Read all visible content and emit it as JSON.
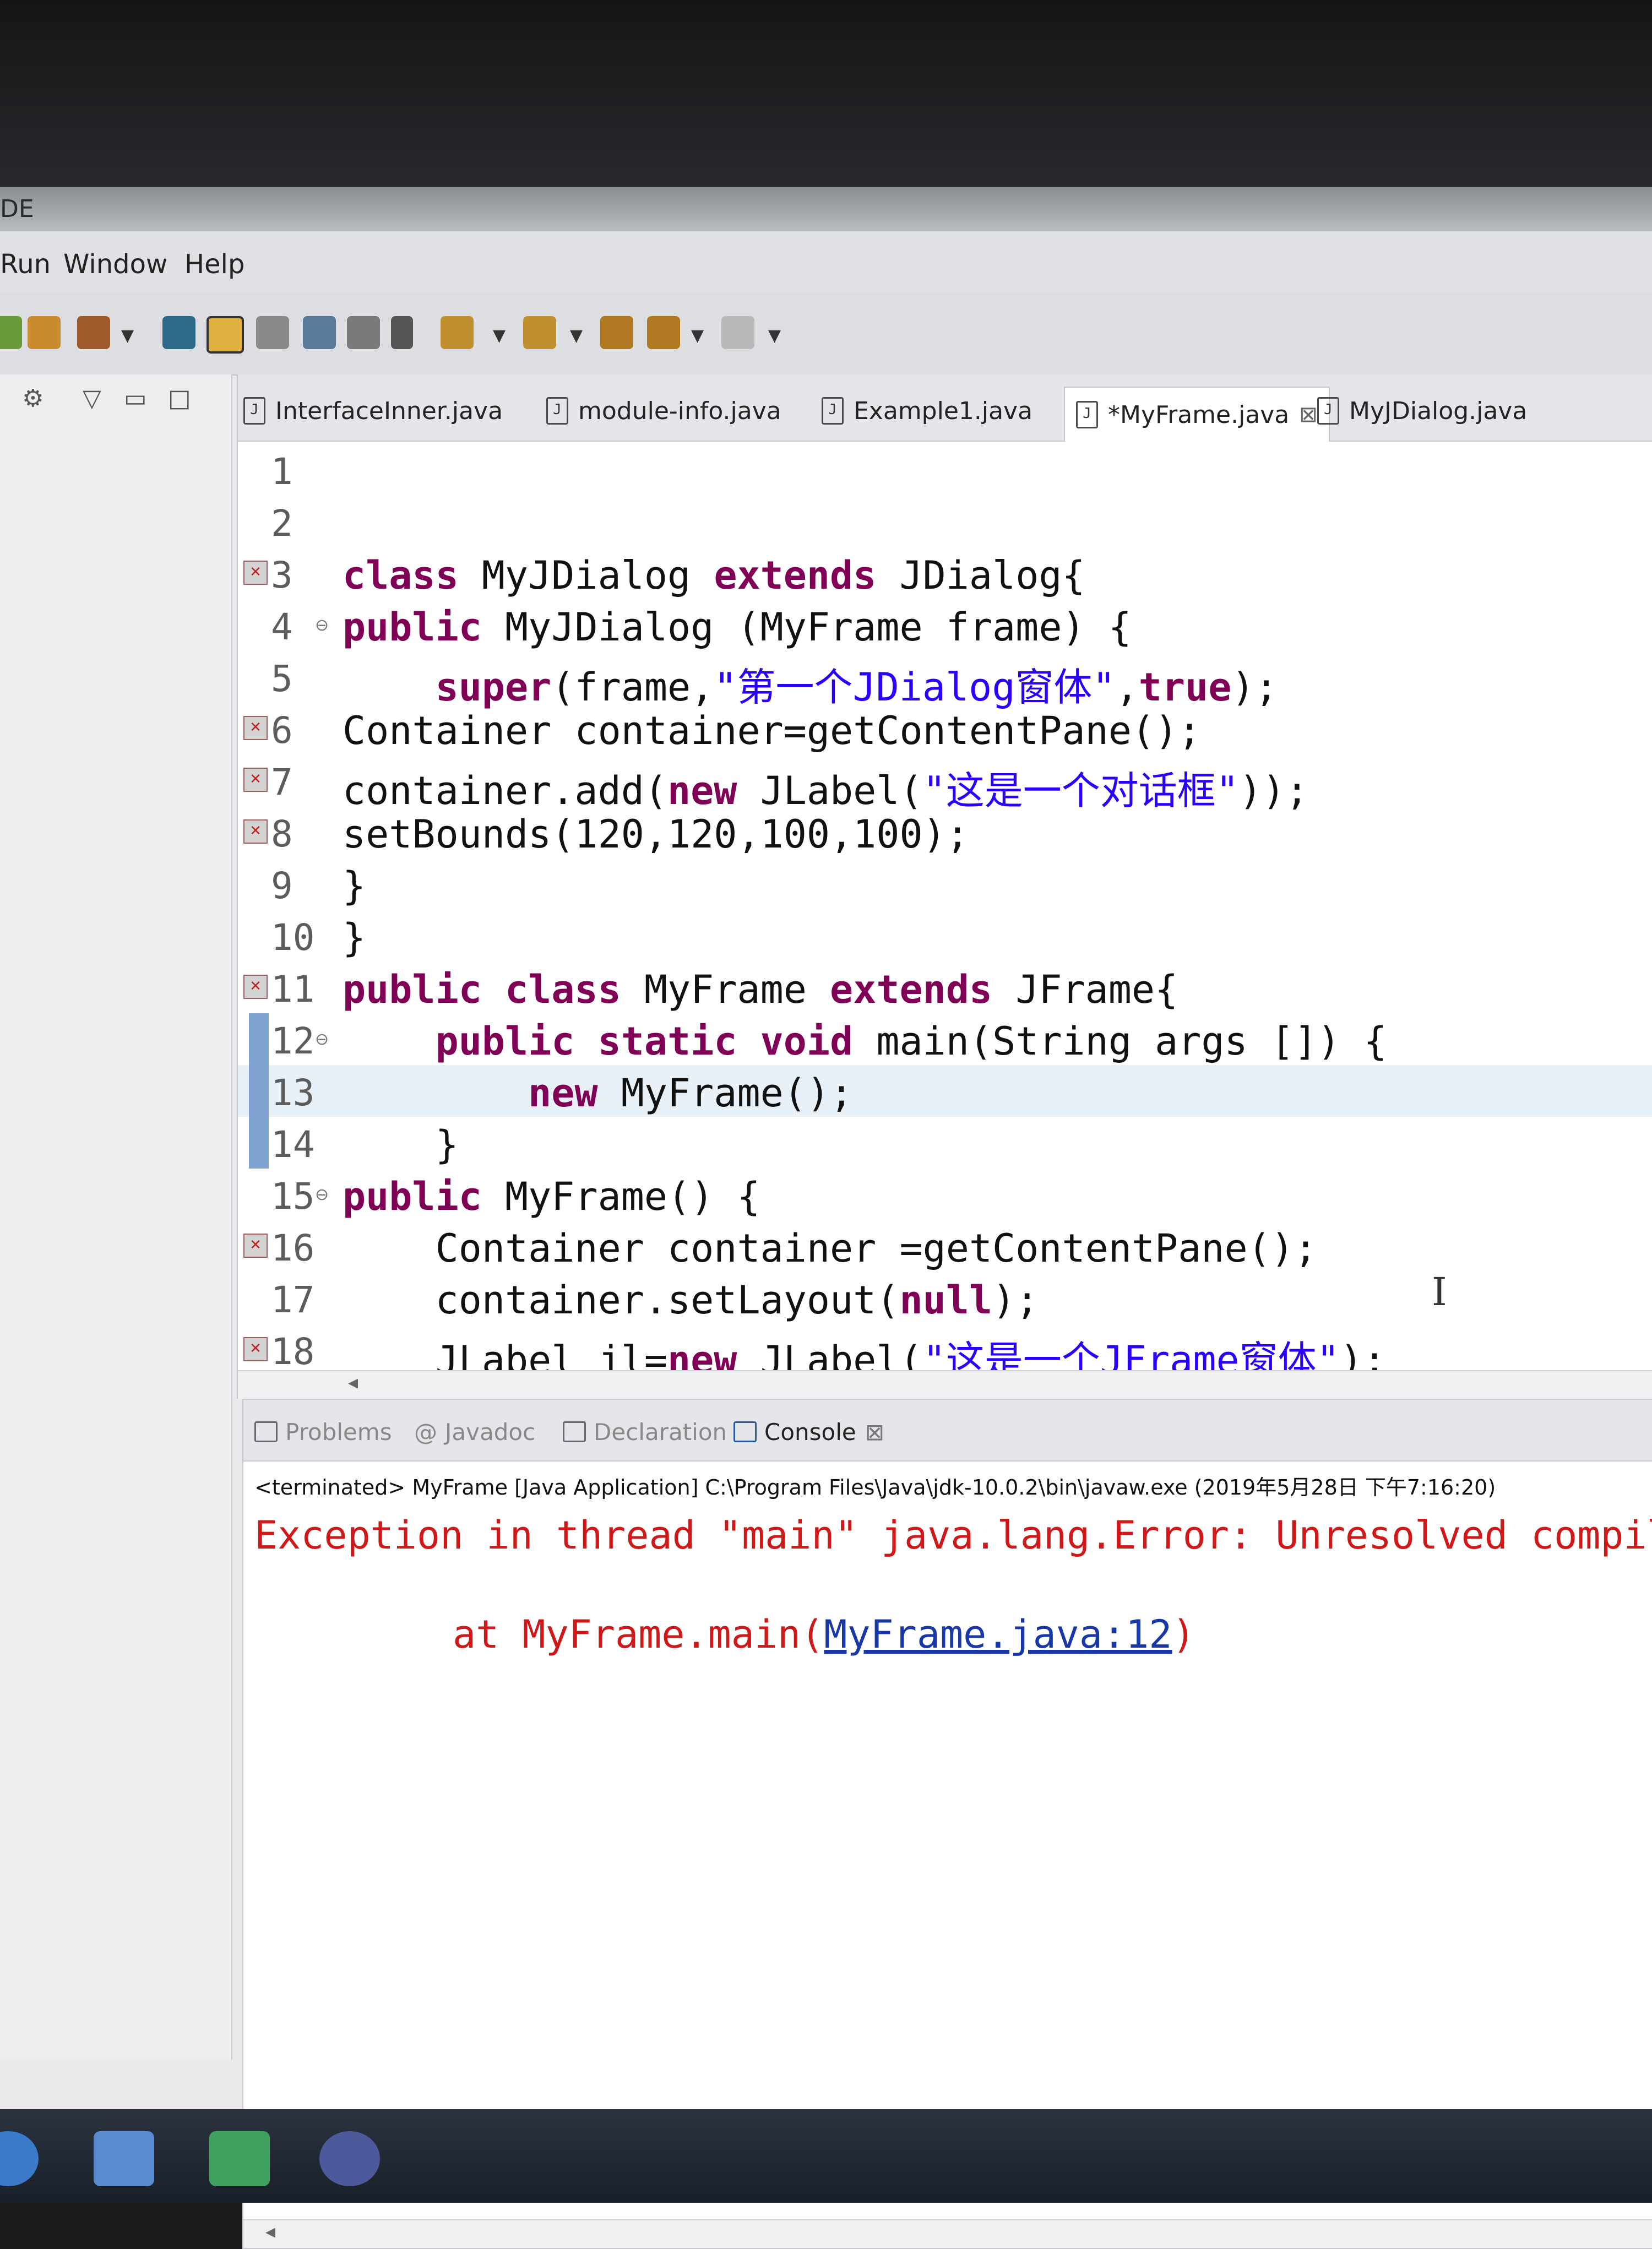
{
  "titlebar": {
    "title": "DE"
  },
  "menubar": {
    "items": [
      "Run",
      "Window",
      "Help"
    ]
  },
  "editor": {
    "tabs": [
      {
        "label": "InterfaceInner.java",
        "active": false
      },
      {
        "label": "module-info.java",
        "active": false
      },
      {
        "label": "Example1.java",
        "active": false
      },
      {
        "label": "*MyFrame.java",
        "active": true
      },
      {
        "label": "MyJDialog.java",
        "active": false
      }
    ],
    "lines": [
      {
        "n": "1",
        "text": ""
      },
      {
        "n": "2",
        "text": ""
      },
      {
        "n": "3",
        "text": "class MyJDialog extends JDialog{",
        "error": true
      },
      {
        "n": "4",
        "text": "public MyJDialog (MyFrame frame) {",
        "fold": true
      },
      {
        "n": "5",
        "text": "    super(frame,\"第一个JDialog窗体\",true);"
      },
      {
        "n": "6",
        "text": "Container container=getContentPane();",
        "error": true
      },
      {
        "n": "7",
        "text": "container.add(new JLabel(\"这是一个对话框\"));",
        "error": true
      },
      {
        "n": "8",
        "text": "setBounds(120,120,100,100);",
        "error": true
      },
      {
        "n": "9",
        "text": "}"
      },
      {
        "n": "10",
        "text": "}"
      },
      {
        "n": "11",
        "text": "public class MyFrame extends JFrame{",
        "error": true
      },
      {
        "n": "12",
        "text": "    public static void main(String args []) {",
        "fold": true
      },
      {
        "n": "13",
        "text": "        new MyFrame();",
        "current": true
      },
      {
        "n": "14",
        "text": "    }"
      },
      {
        "n": "15",
        "text": "public MyFrame() {",
        "fold": true
      },
      {
        "n": "16",
        "text": "    Container container =getContentPane();",
        "error": true
      },
      {
        "n": "17",
        "text": "    container.setLayout(null);"
      },
      {
        "n": "18",
        "text": "    JLabel jl=new JLabel(\"这是一个JFrame窗体\");",
        "error": true
      }
    ]
  },
  "console": {
    "tabs": [
      {
        "label": "Problems",
        "active": false
      },
      {
        "label": "Javadoc",
        "active": false
      },
      {
        "label": "Declaration",
        "active": false
      },
      {
        "label": "Console",
        "active": true
      }
    ],
    "launch_info": "<terminated> MyFrame [Java Application] C:\\Program Files\\Java\\jdk-10.0.2\\bin\\javaw.exe (2019年5月28日 下午7:16:20)",
    "exception": "Exception in thread \"main\" java.lang.Error: Unresolved compil",
    "stack_prefix": "at MyFrame.main(",
    "stack_link": "MyFrame.java:12",
    "stack_suffix": ")"
  },
  "colors": {
    "keyword": "#7f0055",
    "string": "#2a00ff",
    "error_text": "#d01818",
    "link": "#1838a8",
    "current_line": "#e8f0f8"
  },
  "icons": [
    "save-icon",
    "build-icon",
    "run-icon",
    "search-icon",
    "nav-back-icon",
    "nav-forward-icon"
  ]
}
